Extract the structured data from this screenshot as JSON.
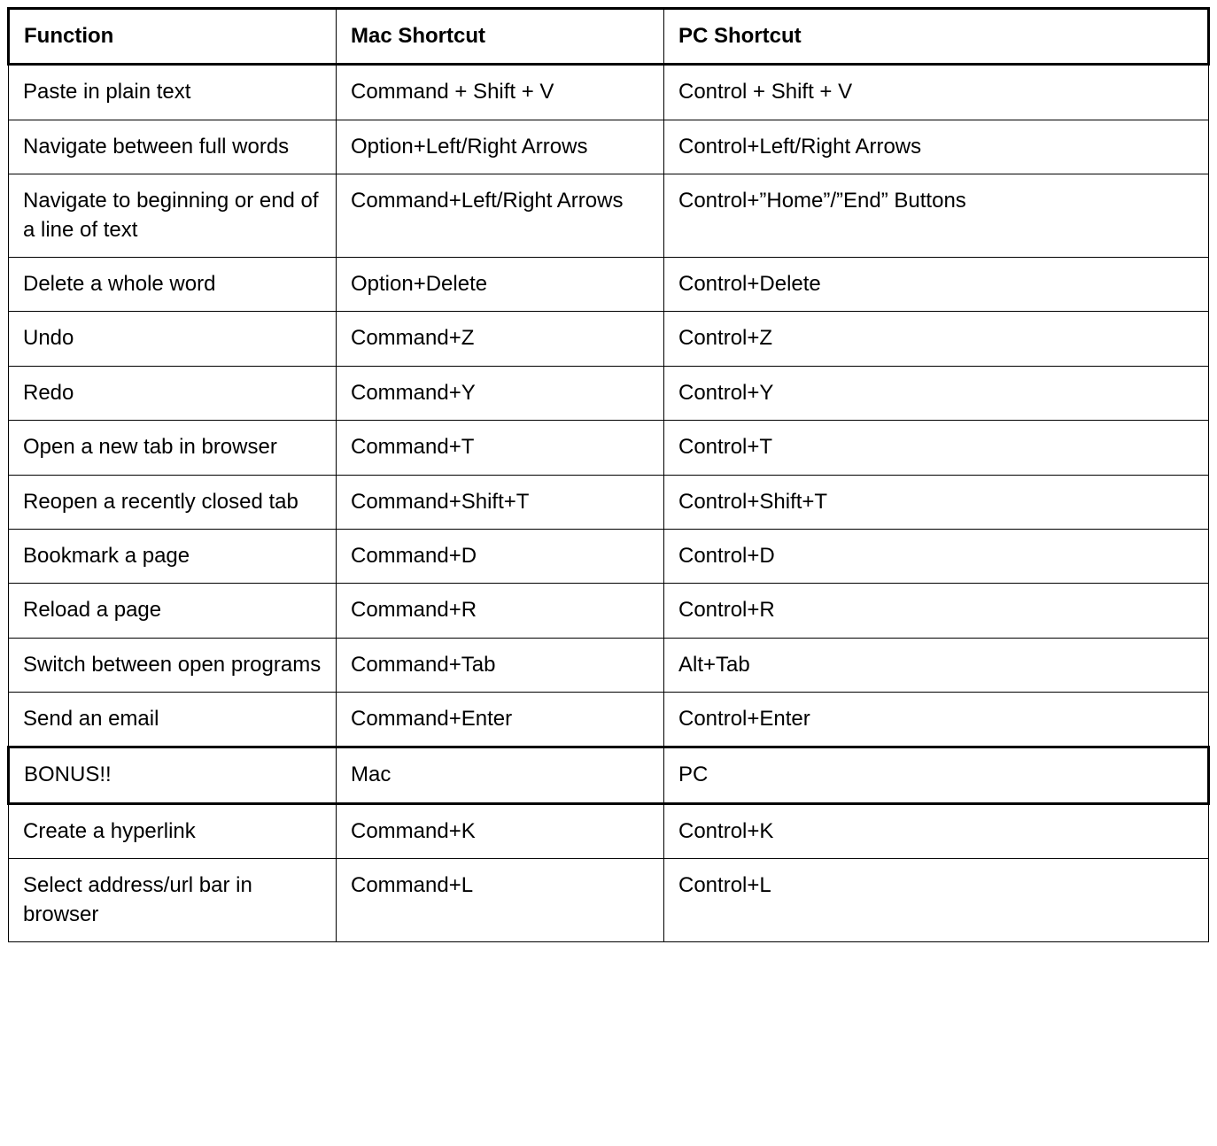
{
  "header": {
    "function": "Function",
    "mac": "Mac Shortcut",
    "pc": "PC Shortcut"
  },
  "rows": [
    {
      "function": "Paste in plain text",
      "mac": "Command + Shift + V",
      "pc": "Control + Shift + V"
    },
    {
      "function": "Navigate between full words",
      "mac": "Option+Left/Right Arrows",
      "pc": "Control+Left/Right Arrows"
    },
    {
      "function": "Navigate to beginning or end of a line of text",
      "mac": "Command+Left/Right Arrows",
      "pc": "Control+”Home”/”End” Buttons"
    },
    {
      "function": "Delete a whole word",
      "mac": "Option+Delete",
      "pc": "Control+Delete"
    },
    {
      "function": "Undo",
      "mac": "Command+Z",
      "pc": "Control+Z"
    },
    {
      "function": "Redo",
      "mac": "Command+Y",
      "pc": "Control+Y"
    },
    {
      "function": "Open a new tab in browser",
      "mac": "Command+T",
      "pc": "Control+T"
    },
    {
      "function": "Reopen a recently closed tab",
      "mac": "Command+Shift+T",
      "pc": "Control+Shift+T"
    },
    {
      "function": "Bookmark a page",
      "mac": "Command+D",
      "pc": "Control+D"
    },
    {
      "function": "Reload a page",
      "mac": "Command+R",
      "pc": "Control+R"
    },
    {
      "function": "Switch between open programs",
      "mac": "Command+Tab",
      "pc": "Alt+Tab"
    },
    {
      "function": "Send an email",
      "mac": "Command+Enter",
      "pc": "Control+Enter"
    }
  ],
  "bonus_header": {
    "function": "BONUS!!",
    "mac": "Mac",
    "pc": "PC"
  },
  "bonus_rows": [
    {
      "function": "Create a hyperlink",
      "mac": "Command+K",
      "pc": "Control+K"
    },
    {
      "function": "Select address/url bar in browser",
      "mac": "Command+L",
      "pc": "Control+L"
    }
  ]
}
